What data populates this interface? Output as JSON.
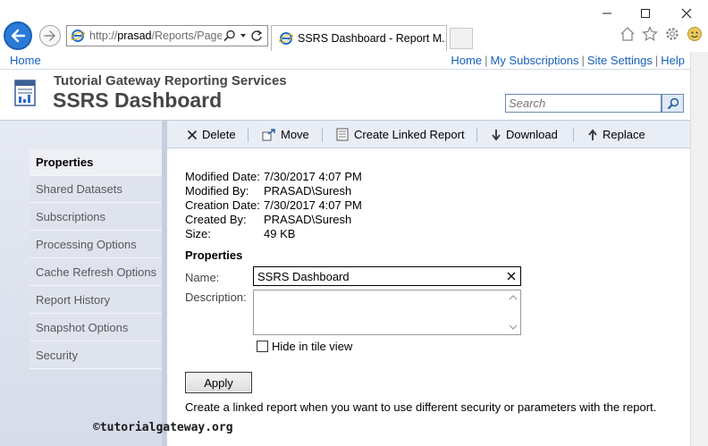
{
  "browser": {
    "url_prefix": "http://",
    "url_host": "prasad",
    "url_path": "/Reports/Pages",
    "tab_title": "SSRS Dashboard - Report M...",
    "window_controls": [
      "minimize-icon",
      "maximize-icon",
      "close-icon"
    ],
    "toolbar_icons": [
      "home-icon",
      "favorites-star-icon",
      "settings-gear-icon",
      "smiley-feedback-icon"
    ]
  },
  "top_links": {
    "home_left": "Home",
    "home": "Home",
    "my_subscriptions": "My Subscriptions",
    "site_settings": "Site Settings",
    "help": "Help",
    "separator": "|"
  },
  "header": {
    "org_name": "Tutorial Gateway Reporting Services",
    "title": "SSRS Dashboard",
    "search_placeholder": "Search"
  },
  "nav": {
    "items": [
      {
        "label": "Properties",
        "active": true
      },
      {
        "label": "Shared Datasets",
        "active": false
      },
      {
        "label": "Subscriptions",
        "active": false
      },
      {
        "label": "Processing Options",
        "active": false
      },
      {
        "label": "Cache Refresh Options",
        "active": false
      },
      {
        "label": "Report History",
        "active": false
      },
      {
        "label": "Snapshot Options",
        "active": false
      },
      {
        "label": "Security",
        "active": false
      }
    ]
  },
  "toolbar": {
    "delete": "Delete",
    "move": "Move",
    "create_linked_report": "Create Linked Report",
    "download": "Download",
    "replace": "Replace"
  },
  "meta": {
    "modified_date_label": "Modified Date:",
    "modified_date": "7/30/2017 4:07 PM",
    "modified_by_label": "Modified By:",
    "modified_by": "PRASAD\\Suresh",
    "creation_date_label": "Creation Date:",
    "creation_date": "7/30/2017 4:07 PM",
    "created_by_label": "Created By:",
    "created_by": "PRASAD\\Suresh",
    "size_label": "Size:",
    "size": "49 KB"
  },
  "properties": {
    "section_title": "Properties",
    "name_label": "Name:",
    "name_value": "SSRS Dashboard",
    "description_label": "Description:",
    "description_value": "",
    "hide_in_tile_view_label": "Hide in tile view",
    "hide_in_tile_view_checked": false,
    "apply_label": "Apply",
    "help_text": "Create a linked report when you want to use different security or parameters with the report."
  },
  "watermark": "©tutorialgateway.org"
}
